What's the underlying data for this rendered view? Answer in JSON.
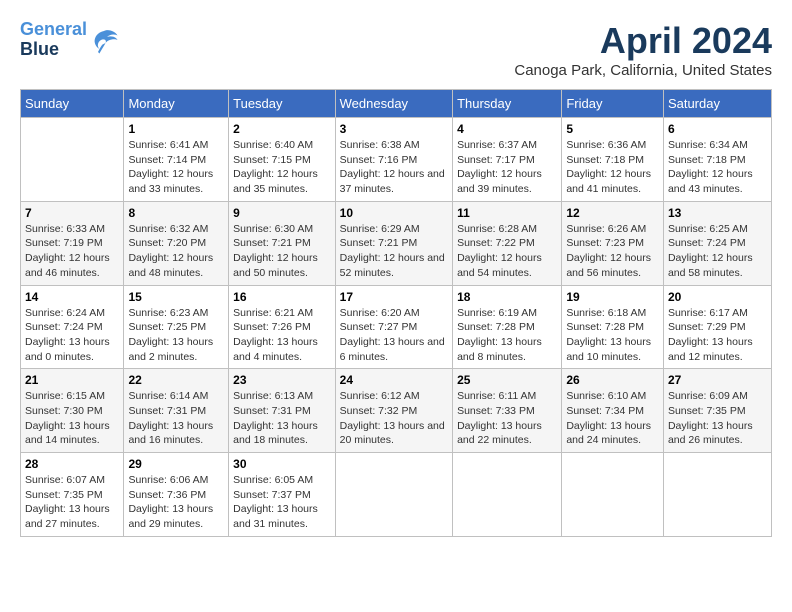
{
  "header": {
    "logo_line1": "General",
    "logo_line2": "Blue",
    "month_title": "April 2024",
    "location": "Canoga Park, California, United States"
  },
  "days_of_week": [
    "Sunday",
    "Monday",
    "Tuesday",
    "Wednesday",
    "Thursday",
    "Friday",
    "Saturday"
  ],
  "weeks": [
    [
      {
        "day": "",
        "sunrise": "",
        "sunset": "",
        "daylight": ""
      },
      {
        "day": "1",
        "sunrise": "Sunrise: 6:41 AM",
        "sunset": "Sunset: 7:14 PM",
        "daylight": "Daylight: 12 hours and 33 minutes."
      },
      {
        "day": "2",
        "sunrise": "Sunrise: 6:40 AM",
        "sunset": "Sunset: 7:15 PM",
        "daylight": "Daylight: 12 hours and 35 minutes."
      },
      {
        "day": "3",
        "sunrise": "Sunrise: 6:38 AM",
        "sunset": "Sunset: 7:16 PM",
        "daylight": "Daylight: 12 hours and 37 minutes."
      },
      {
        "day": "4",
        "sunrise": "Sunrise: 6:37 AM",
        "sunset": "Sunset: 7:17 PM",
        "daylight": "Daylight: 12 hours and 39 minutes."
      },
      {
        "day": "5",
        "sunrise": "Sunrise: 6:36 AM",
        "sunset": "Sunset: 7:18 PM",
        "daylight": "Daylight: 12 hours and 41 minutes."
      },
      {
        "day": "6",
        "sunrise": "Sunrise: 6:34 AM",
        "sunset": "Sunset: 7:18 PM",
        "daylight": "Daylight: 12 hours and 43 minutes."
      }
    ],
    [
      {
        "day": "7",
        "sunrise": "Sunrise: 6:33 AM",
        "sunset": "Sunset: 7:19 PM",
        "daylight": "Daylight: 12 hours and 46 minutes."
      },
      {
        "day": "8",
        "sunrise": "Sunrise: 6:32 AM",
        "sunset": "Sunset: 7:20 PM",
        "daylight": "Daylight: 12 hours and 48 minutes."
      },
      {
        "day": "9",
        "sunrise": "Sunrise: 6:30 AM",
        "sunset": "Sunset: 7:21 PM",
        "daylight": "Daylight: 12 hours and 50 minutes."
      },
      {
        "day": "10",
        "sunrise": "Sunrise: 6:29 AM",
        "sunset": "Sunset: 7:21 PM",
        "daylight": "Daylight: 12 hours and 52 minutes."
      },
      {
        "day": "11",
        "sunrise": "Sunrise: 6:28 AM",
        "sunset": "Sunset: 7:22 PM",
        "daylight": "Daylight: 12 hours and 54 minutes."
      },
      {
        "day": "12",
        "sunrise": "Sunrise: 6:26 AM",
        "sunset": "Sunset: 7:23 PM",
        "daylight": "Daylight: 12 hours and 56 minutes."
      },
      {
        "day": "13",
        "sunrise": "Sunrise: 6:25 AM",
        "sunset": "Sunset: 7:24 PM",
        "daylight": "Daylight: 12 hours and 58 minutes."
      }
    ],
    [
      {
        "day": "14",
        "sunrise": "Sunrise: 6:24 AM",
        "sunset": "Sunset: 7:24 PM",
        "daylight": "Daylight: 13 hours and 0 minutes."
      },
      {
        "day": "15",
        "sunrise": "Sunrise: 6:23 AM",
        "sunset": "Sunset: 7:25 PM",
        "daylight": "Daylight: 13 hours and 2 minutes."
      },
      {
        "day": "16",
        "sunrise": "Sunrise: 6:21 AM",
        "sunset": "Sunset: 7:26 PM",
        "daylight": "Daylight: 13 hours and 4 minutes."
      },
      {
        "day": "17",
        "sunrise": "Sunrise: 6:20 AM",
        "sunset": "Sunset: 7:27 PM",
        "daylight": "Daylight: 13 hours and 6 minutes."
      },
      {
        "day": "18",
        "sunrise": "Sunrise: 6:19 AM",
        "sunset": "Sunset: 7:28 PM",
        "daylight": "Daylight: 13 hours and 8 minutes."
      },
      {
        "day": "19",
        "sunrise": "Sunrise: 6:18 AM",
        "sunset": "Sunset: 7:28 PM",
        "daylight": "Daylight: 13 hours and 10 minutes."
      },
      {
        "day": "20",
        "sunrise": "Sunrise: 6:17 AM",
        "sunset": "Sunset: 7:29 PM",
        "daylight": "Daylight: 13 hours and 12 minutes."
      }
    ],
    [
      {
        "day": "21",
        "sunrise": "Sunrise: 6:15 AM",
        "sunset": "Sunset: 7:30 PM",
        "daylight": "Daylight: 13 hours and 14 minutes."
      },
      {
        "day": "22",
        "sunrise": "Sunrise: 6:14 AM",
        "sunset": "Sunset: 7:31 PM",
        "daylight": "Daylight: 13 hours and 16 minutes."
      },
      {
        "day": "23",
        "sunrise": "Sunrise: 6:13 AM",
        "sunset": "Sunset: 7:31 PM",
        "daylight": "Daylight: 13 hours and 18 minutes."
      },
      {
        "day": "24",
        "sunrise": "Sunrise: 6:12 AM",
        "sunset": "Sunset: 7:32 PM",
        "daylight": "Daylight: 13 hours and 20 minutes."
      },
      {
        "day": "25",
        "sunrise": "Sunrise: 6:11 AM",
        "sunset": "Sunset: 7:33 PM",
        "daylight": "Daylight: 13 hours and 22 minutes."
      },
      {
        "day": "26",
        "sunrise": "Sunrise: 6:10 AM",
        "sunset": "Sunset: 7:34 PM",
        "daylight": "Daylight: 13 hours and 24 minutes."
      },
      {
        "day": "27",
        "sunrise": "Sunrise: 6:09 AM",
        "sunset": "Sunset: 7:35 PM",
        "daylight": "Daylight: 13 hours and 26 minutes."
      }
    ],
    [
      {
        "day": "28",
        "sunrise": "Sunrise: 6:07 AM",
        "sunset": "Sunset: 7:35 PM",
        "daylight": "Daylight: 13 hours and 27 minutes."
      },
      {
        "day": "29",
        "sunrise": "Sunrise: 6:06 AM",
        "sunset": "Sunset: 7:36 PM",
        "daylight": "Daylight: 13 hours and 29 minutes."
      },
      {
        "day": "30",
        "sunrise": "Sunrise: 6:05 AM",
        "sunset": "Sunset: 7:37 PM",
        "daylight": "Daylight: 13 hours and 31 minutes."
      },
      {
        "day": "",
        "sunrise": "",
        "sunset": "",
        "daylight": ""
      },
      {
        "day": "",
        "sunrise": "",
        "sunset": "",
        "daylight": ""
      },
      {
        "day": "",
        "sunrise": "",
        "sunset": "",
        "daylight": ""
      },
      {
        "day": "",
        "sunrise": "",
        "sunset": "",
        "daylight": ""
      }
    ]
  ]
}
